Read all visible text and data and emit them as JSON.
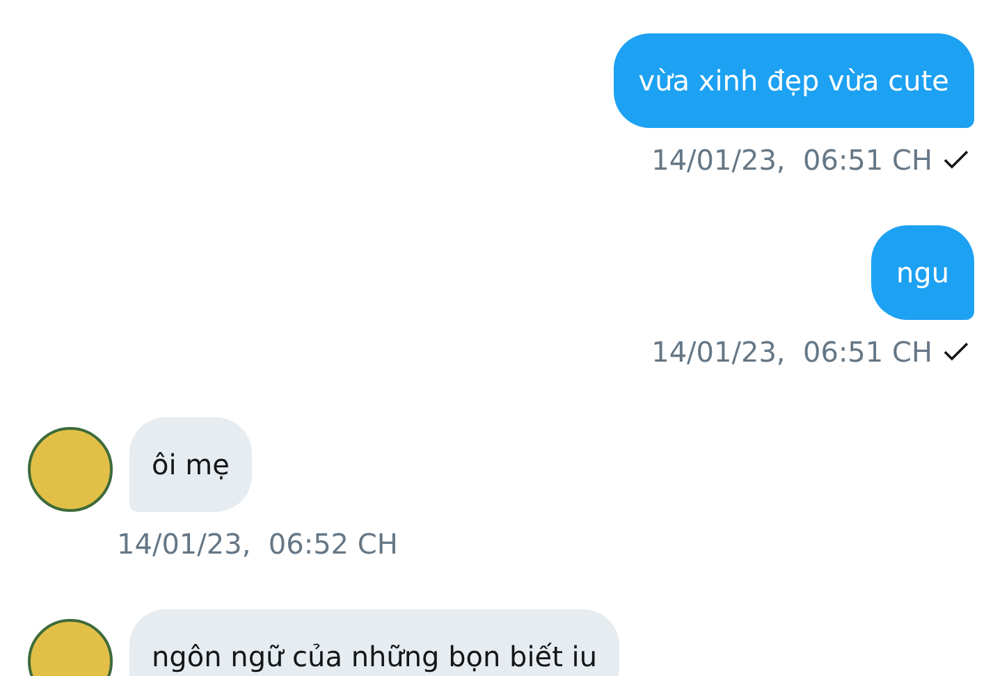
{
  "messages": [
    {
      "kind": "outgoing",
      "text": "vừa xinh đẹp vừa cute",
      "time": "14/01/23,  06:51 CH",
      "delivered": true
    },
    {
      "kind": "outgoing",
      "text": "ngu",
      "time": "14/01/23,  06:51 CH",
      "delivered": true
    },
    {
      "kind": "incoming",
      "text": "ôi mẹ",
      "time": "14/01/23,  06:52 CH"
    },
    {
      "kind": "incoming",
      "text": "ngôn ngữ của những bọn biết iu"
    }
  ]
}
